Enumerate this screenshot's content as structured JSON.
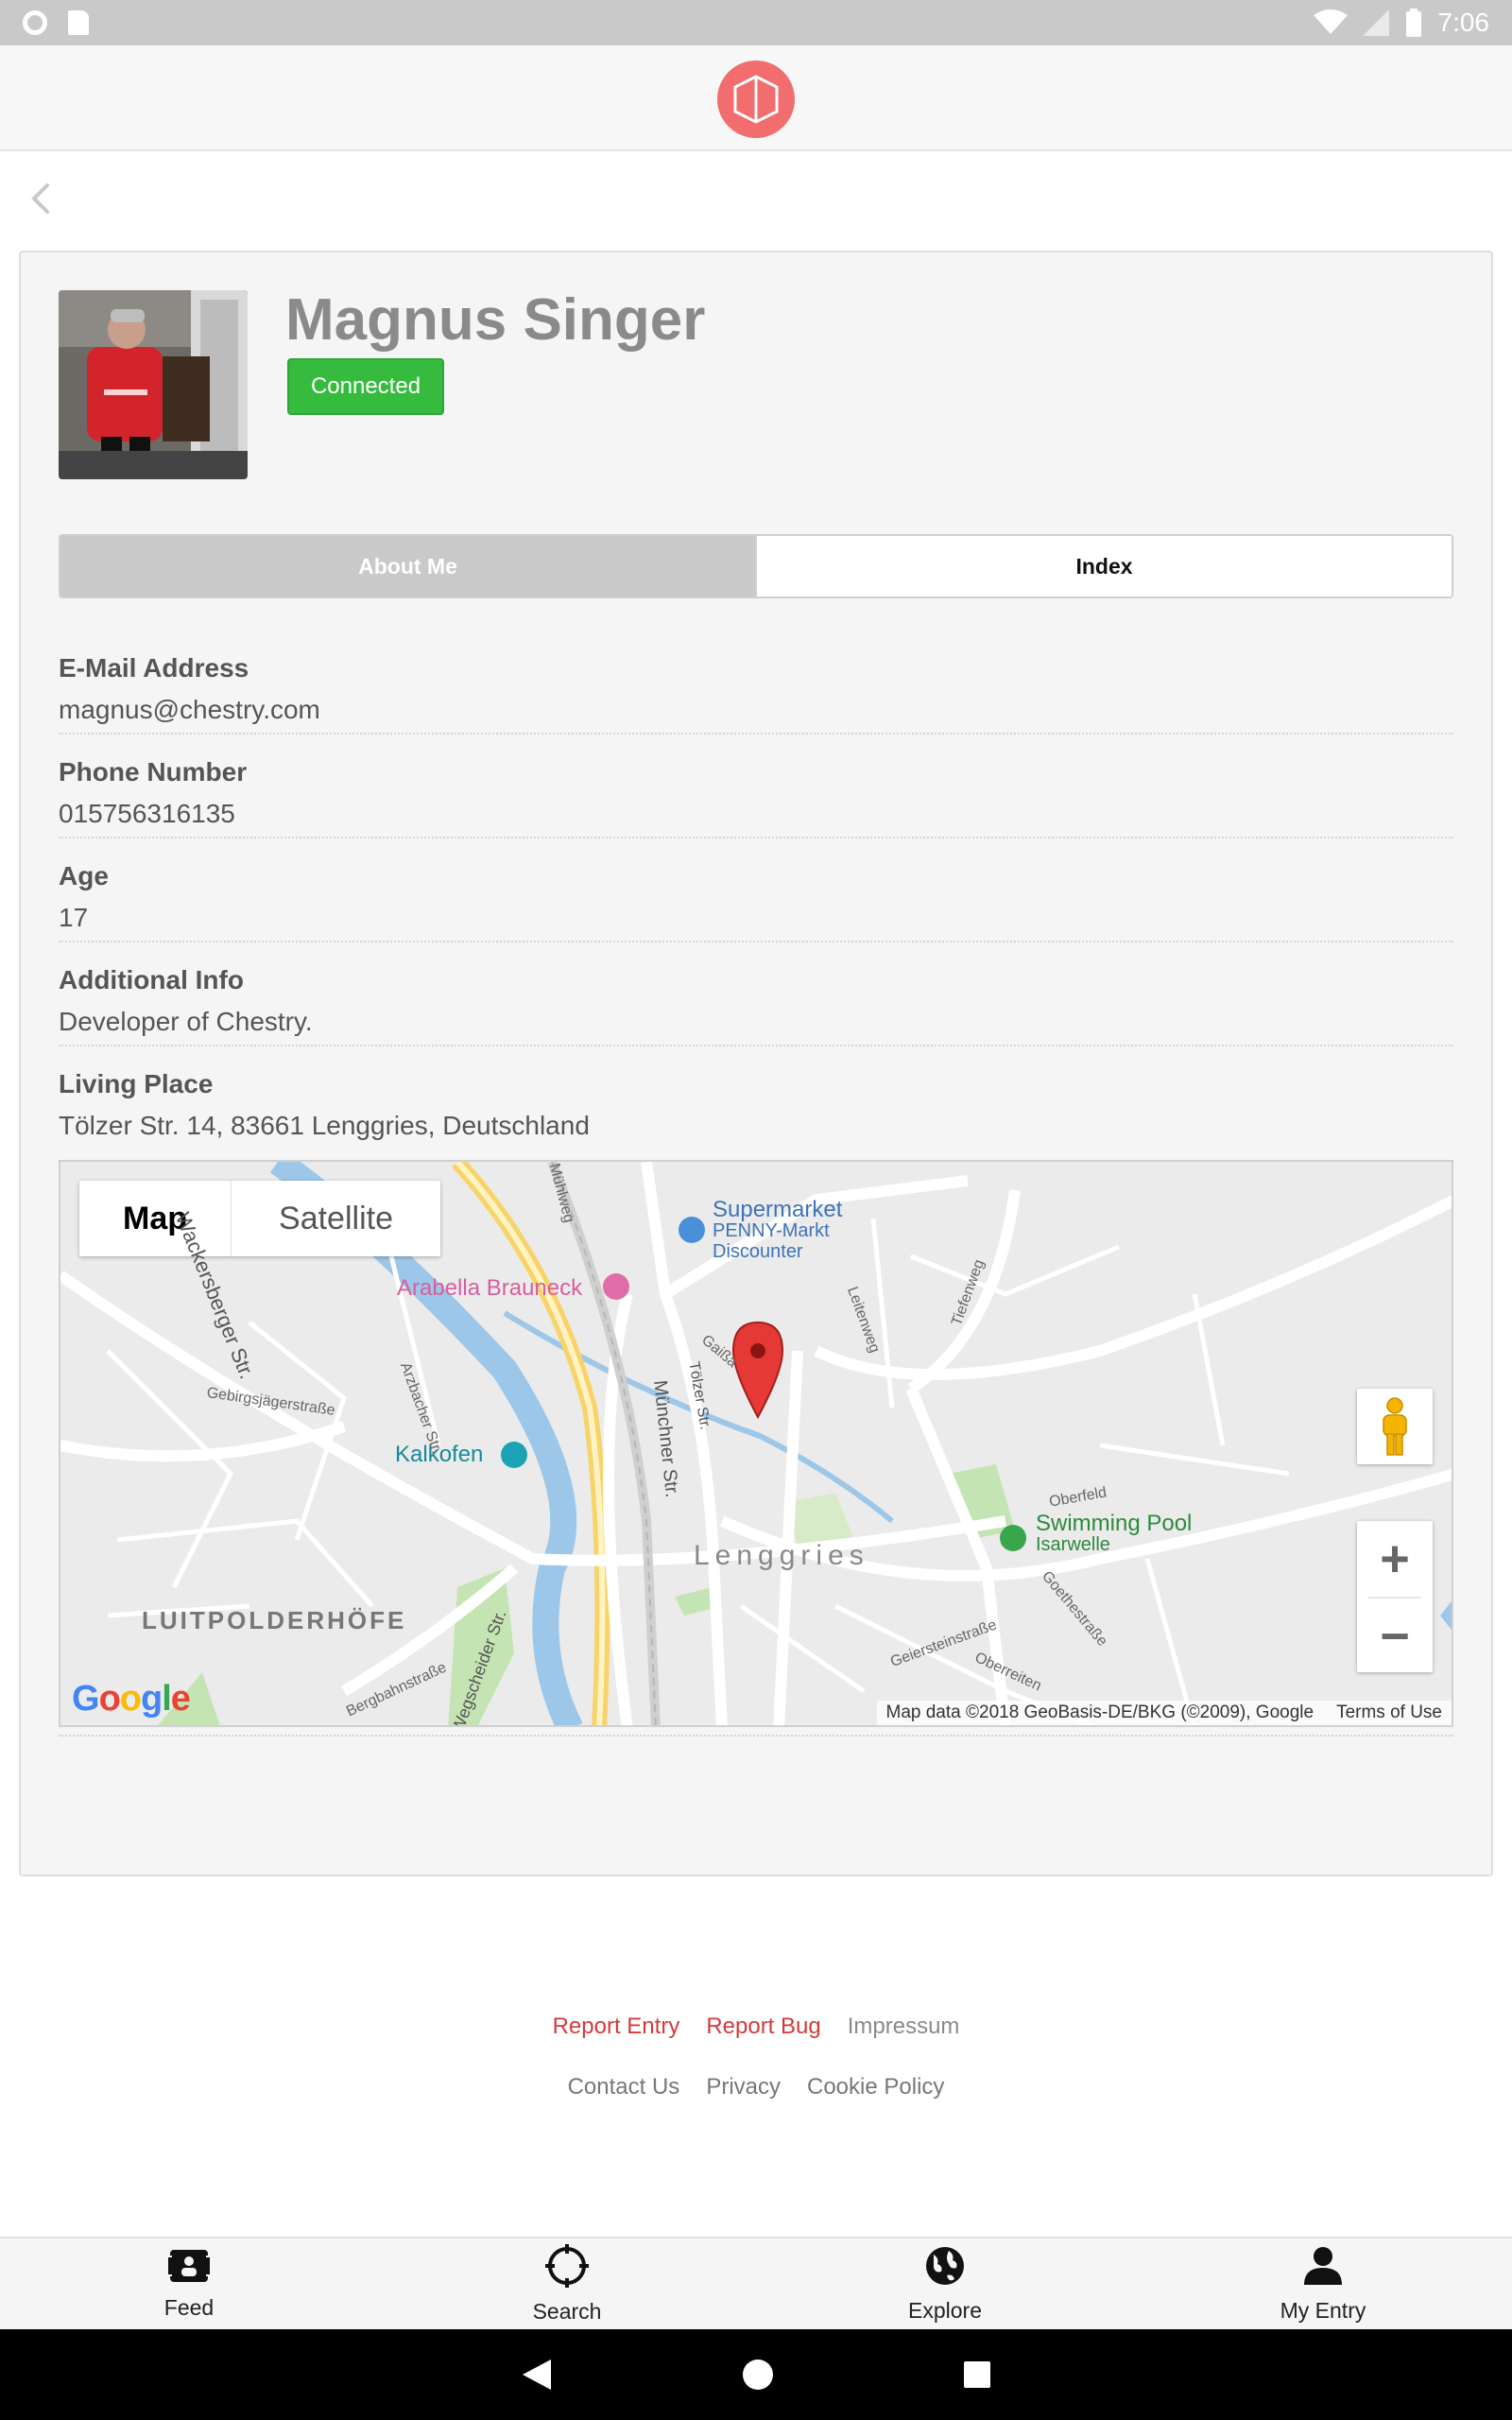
{
  "status_bar": {
    "time": "7:06"
  },
  "profile": {
    "name": "Magnus Singer",
    "status": "Connected"
  },
  "tabs": [
    {
      "label": "About Me",
      "active": true
    },
    {
      "label": "Index",
      "active": false
    }
  ],
  "fields": [
    {
      "label": "E-Mail Address",
      "value": "magnus@chestry.com"
    },
    {
      "label": "Phone Number",
      "value": "015756316135"
    },
    {
      "label": "Age",
      "value": "17"
    },
    {
      "label": "Additional Info",
      "value": "Developer of Chestry."
    },
    {
      "label": "Living Place",
      "value": "Tölzer Str. 14, 83661 Lenggries, Deutschland"
    }
  ],
  "map": {
    "toggle": {
      "map": "Map",
      "satellite": "Satellite"
    },
    "labels": {
      "supermarket": "Supermarket",
      "penny": "PENNY-Markt",
      "discounter": "Discounter",
      "arabella": "Arabella Brauneck",
      "kalkofen": "Kalkofen",
      "swimming": "Swimming Pool",
      "isarwelle": "Isarwelle",
      "lenggries": "Lenggries",
      "luitpolderhofe": "LUITPOLDERHÖFE",
      "wackersberger": "Wackersberger Str.",
      "muenchner": "Münchner Str.",
      "toelzer": "Tölzer Str.",
      "gebirgsjaeger": "Gebirgsjägerstraße",
      "arzbacher": "Arzbacher Str.",
      "leitenweg": "Leitenweg",
      "tiefenweg": "Tiefenweg",
      "oberfeld": "Oberfeld",
      "goethestrasse": "Goethestraße",
      "geiersteinstrasse": "Geiersteinstraße",
      "oberreiten": "Oberreiten",
      "bergbahnstrasse": "Bergbahnstraße",
      "wegscheider": "Wegscheider Str.",
      "muehlweg": "Mühlweg",
      "gaissach": "Gaißa"
    },
    "attribution": "Map data ©2018 GeoBasis-DE/BKG (©2009), Google",
    "terms": "Terms of Use",
    "google": [
      "G",
      "o",
      "o",
      "g",
      "l",
      "e"
    ],
    "google_colors": [
      "#4285F4",
      "#EA4335",
      "#FBBC05",
      "#4285F4",
      "#34A853",
      "#EA4335"
    ]
  },
  "footer": {
    "report_entry": "Report Entry",
    "report_bug": "Report Bug",
    "impressum": "Impressum",
    "contact": "Contact Us",
    "privacy": "Privacy",
    "cookie": "Cookie Policy"
  },
  "bottom_nav": [
    {
      "label": "Feed",
      "icon": "feed-icon"
    },
    {
      "label": "Search",
      "icon": "crosshair-icon"
    },
    {
      "label": "Explore",
      "icon": "globe-icon"
    },
    {
      "label": "My Entry",
      "icon": "user-icon"
    }
  ],
  "colors": {
    "accent": "#f26d6d",
    "connected": "#36bb3f",
    "link_red": "#d23b3b"
  }
}
